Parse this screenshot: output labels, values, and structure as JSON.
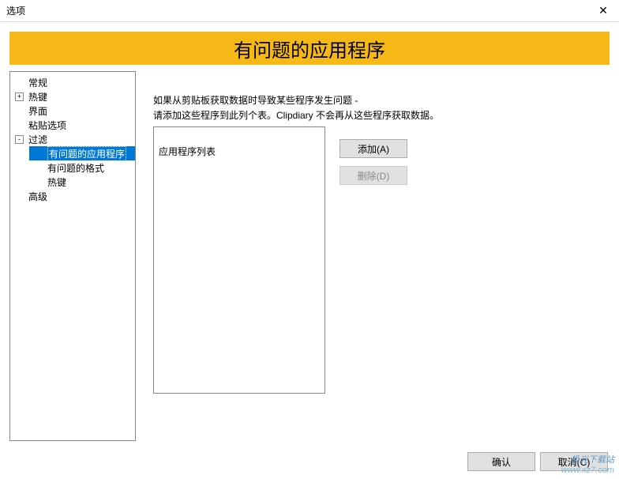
{
  "window": {
    "title": "选项",
    "close": "✕"
  },
  "banner": {
    "title": "有问题的应用程序"
  },
  "tree": {
    "items": [
      {
        "label": "常规",
        "indent": 0,
        "expander": null
      },
      {
        "label": "热键",
        "indent": 0,
        "expander": "+"
      },
      {
        "label": "界面",
        "indent": 0,
        "expander": null
      },
      {
        "label": "粘贴选项",
        "indent": 0,
        "expander": null
      },
      {
        "label": "过滤",
        "indent": 0,
        "expander": "-"
      },
      {
        "label": "有问题的应用程序",
        "indent": 1,
        "expander": null,
        "selected": true
      },
      {
        "label": "有问题的格式",
        "indent": 1,
        "expander": null
      },
      {
        "label": "热键",
        "indent": 1,
        "expander": null
      },
      {
        "label": "高级",
        "indent": 0,
        "expander": null
      }
    ]
  },
  "main": {
    "desc_line1": "如果从剪贴板获取数据时导致某些程序发生问题 -",
    "desc_line2": "请添加这些程序到此列个表。Clipdiary 不会再从这些程序获取数据。",
    "listbox_label": "应用程序列表",
    "add_button": "添加(A)",
    "delete_button": "删除(D)"
  },
  "footer": {
    "ok": "确认",
    "cancel": "取消(C)"
  },
  "watermark": {
    "line1": "极光下载站",
    "line2": "www.xz7.com"
  }
}
